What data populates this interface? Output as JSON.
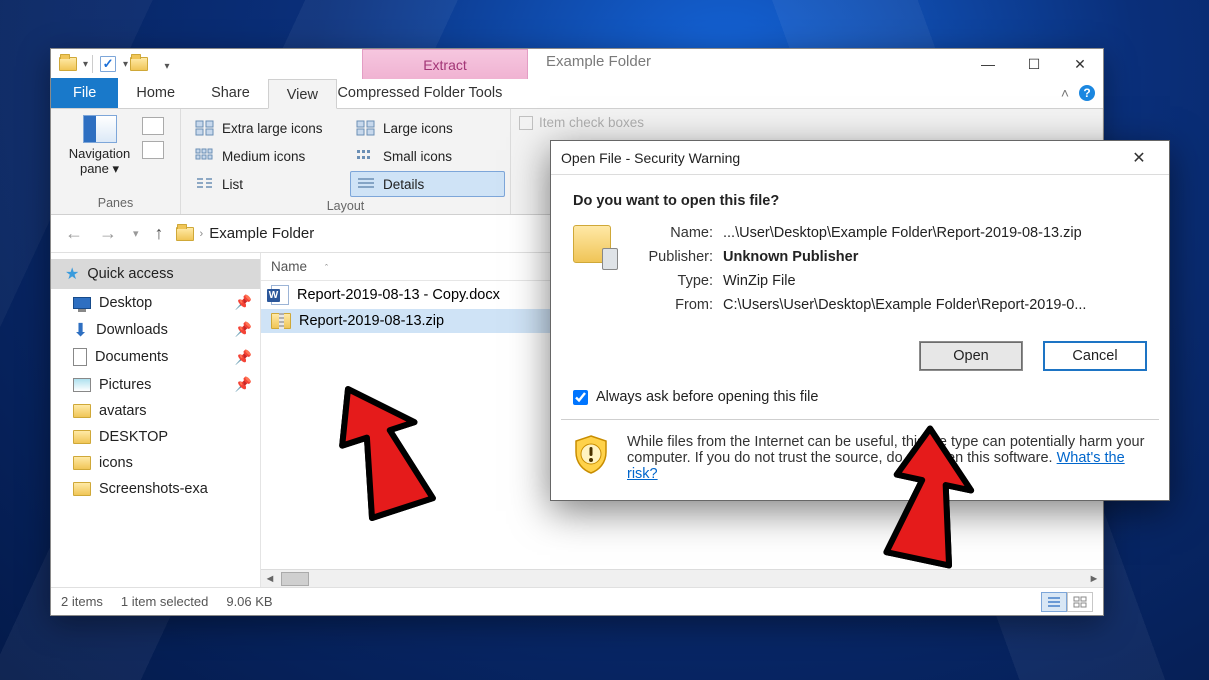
{
  "window": {
    "title": "Example Folder",
    "min": "—",
    "max": "☐",
    "close": "✕"
  },
  "context_tab": {
    "label": "Extract",
    "tool_label": "Compressed Folder Tools"
  },
  "tabs": {
    "file": "File",
    "home": "Home",
    "share": "Share",
    "view": "View"
  },
  "ribbon": {
    "panes_label": "Panes",
    "nav_pane": "Navigation\npane ▾",
    "layout_label": "Layout",
    "layouts": {
      "xl": "Extra large icons",
      "l": "Large icons",
      "m": "Medium icons",
      "s": "Small icons",
      "list": "List",
      "details": "Details"
    },
    "item_checkboxes": "Item check boxes"
  },
  "breadcrumb": {
    "root_sep": "›",
    "folder": "Example Folder"
  },
  "nav": {
    "quick_access": "Quick access",
    "items": [
      {
        "label": "Desktop",
        "pin": true
      },
      {
        "label": "Downloads",
        "pin": true
      },
      {
        "label": "Documents",
        "pin": true
      },
      {
        "label": "Pictures",
        "pin": true
      },
      {
        "label": "avatars",
        "pin": false
      },
      {
        "label": "DESKTOP",
        "pin": false
      },
      {
        "label": "icons",
        "pin": false
      },
      {
        "label": "Screenshots-exa",
        "pin": false
      }
    ]
  },
  "columns": {
    "name": "Name"
  },
  "files": [
    {
      "name": "Report-2019-08-13 - Copy.docx",
      "type": "word"
    },
    {
      "name": "Report-2019-08-13.zip",
      "type": "zip",
      "selected": true
    }
  ],
  "status": {
    "items": "2 items",
    "selected": "1 item selected",
    "size": "9.06 KB"
  },
  "dialog": {
    "title": "Open File - Security Warning",
    "question": "Do you want to open this file?",
    "labels": {
      "name": "Name:",
      "publisher": "Publisher:",
      "type": "Type:",
      "from": "From:"
    },
    "name": "...\\User\\Desktop\\Example Folder\\Report-2019-08-13.zip",
    "publisher": "Unknown Publisher",
    "type": "WinZip File",
    "from": "C:\\Users\\User\\Desktop\\Example Folder\\Report-2019-0...",
    "open": "Open",
    "cancel": "Cancel",
    "always_ask": "Always ask before opening this file",
    "warn": "While files from the Internet can be useful, this file type can potentially harm your computer. If you do not trust the source, do not open this software. ",
    "risk_link": "What's the risk?"
  }
}
